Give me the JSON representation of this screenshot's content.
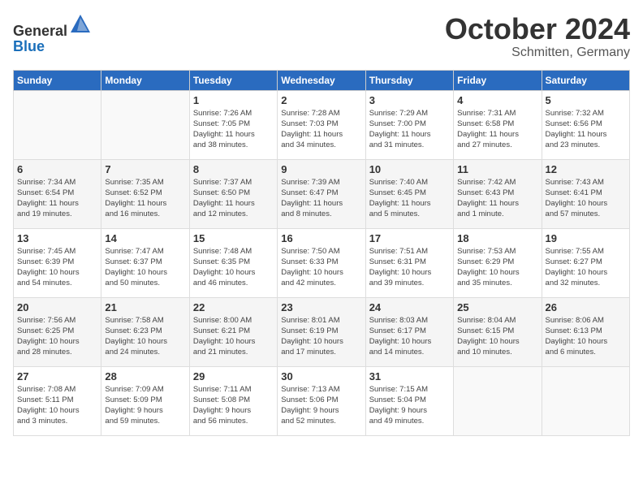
{
  "logo": {
    "general": "General",
    "blue": "Blue"
  },
  "header": {
    "month": "October 2024",
    "location": "Schmitten, Germany"
  },
  "weekdays": [
    "Sunday",
    "Monday",
    "Tuesday",
    "Wednesday",
    "Thursday",
    "Friday",
    "Saturday"
  ],
  "weeks": [
    [
      {
        "day": "",
        "info": ""
      },
      {
        "day": "",
        "info": ""
      },
      {
        "day": "1",
        "info": "Sunrise: 7:26 AM\nSunset: 7:05 PM\nDaylight: 11 hours\nand 38 minutes."
      },
      {
        "day": "2",
        "info": "Sunrise: 7:28 AM\nSunset: 7:03 PM\nDaylight: 11 hours\nand 34 minutes."
      },
      {
        "day": "3",
        "info": "Sunrise: 7:29 AM\nSunset: 7:00 PM\nDaylight: 11 hours\nand 31 minutes."
      },
      {
        "day": "4",
        "info": "Sunrise: 7:31 AM\nSunset: 6:58 PM\nDaylight: 11 hours\nand 27 minutes."
      },
      {
        "day": "5",
        "info": "Sunrise: 7:32 AM\nSunset: 6:56 PM\nDaylight: 11 hours\nand 23 minutes."
      }
    ],
    [
      {
        "day": "6",
        "info": "Sunrise: 7:34 AM\nSunset: 6:54 PM\nDaylight: 11 hours\nand 19 minutes."
      },
      {
        "day": "7",
        "info": "Sunrise: 7:35 AM\nSunset: 6:52 PM\nDaylight: 11 hours\nand 16 minutes."
      },
      {
        "day": "8",
        "info": "Sunrise: 7:37 AM\nSunset: 6:50 PM\nDaylight: 11 hours\nand 12 minutes."
      },
      {
        "day": "9",
        "info": "Sunrise: 7:39 AM\nSunset: 6:47 PM\nDaylight: 11 hours\nand 8 minutes."
      },
      {
        "day": "10",
        "info": "Sunrise: 7:40 AM\nSunset: 6:45 PM\nDaylight: 11 hours\nand 5 minutes."
      },
      {
        "day": "11",
        "info": "Sunrise: 7:42 AM\nSunset: 6:43 PM\nDaylight: 11 hours\nand 1 minute."
      },
      {
        "day": "12",
        "info": "Sunrise: 7:43 AM\nSunset: 6:41 PM\nDaylight: 10 hours\nand 57 minutes."
      }
    ],
    [
      {
        "day": "13",
        "info": "Sunrise: 7:45 AM\nSunset: 6:39 PM\nDaylight: 10 hours\nand 54 minutes."
      },
      {
        "day": "14",
        "info": "Sunrise: 7:47 AM\nSunset: 6:37 PM\nDaylight: 10 hours\nand 50 minutes."
      },
      {
        "day": "15",
        "info": "Sunrise: 7:48 AM\nSunset: 6:35 PM\nDaylight: 10 hours\nand 46 minutes."
      },
      {
        "day": "16",
        "info": "Sunrise: 7:50 AM\nSunset: 6:33 PM\nDaylight: 10 hours\nand 42 minutes."
      },
      {
        "day": "17",
        "info": "Sunrise: 7:51 AM\nSunset: 6:31 PM\nDaylight: 10 hours\nand 39 minutes."
      },
      {
        "day": "18",
        "info": "Sunrise: 7:53 AM\nSunset: 6:29 PM\nDaylight: 10 hours\nand 35 minutes."
      },
      {
        "day": "19",
        "info": "Sunrise: 7:55 AM\nSunset: 6:27 PM\nDaylight: 10 hours\nand 32 minutes."
      }
    ],
    [
      {
        "day": "20",
        "info": "Sunrise: 7:56 AM\nSunset: 6:25 PM\nDaylight: 10 hours\nand 28 minutes."
      },
      {
        "day": "21",
        "info": "Sunrise: 7:58 AM\nSunset: 6:23 PM\nDaylight: 10 hours\nand 24 minutes."
      },
      {
        "day": "22",
        "info": "Sunrise: 8:00 AM\nSunset: 6:21 PM\nDaylight: 10 hours\nand 21 minutes."
      },
      {
        "day": "23",
        "info": "Sunrise: 8:01 AM\nSunset: 6:19 PM\nDaylight: 10 hours\nand 17 minutes."
      },
      {
        "day": "24",
        "info": "Sunrise: 8:03 AM\nSunset: 6:17 PM\nDaylight: 10 hours\nand 14 minutes."
      },
      {
        "day": "25",
        "info": "Sunrise: 8:04 AM\nSunset: 6:15 PM\nDaylight: 10 hours\nand 10 minutes."
      },
      {
        "day": "26",
        "info": "Sunrise: 8:06 AM\nSunset: 6:13 PM\nDaylight: 10 hours\nand 6 minutes."
      }
    ],
    [
      {
        "day": "27",
        "info": "Sunrise: 7:08 AM\nSunset: 5:11 PM\nDaylight: 10 hours\nand 3 minutes."
      },
      {
        "day": "28",
        "info": "Sunrise: 7:09 AM\nSunset: 5:09 PM\nDaylight: 9 hours\nand 59 minutes."
      },
      {
        "day": "29",
        "info": "Sunrise: 7:11 AM\nSunset: 5:08 PM\nDaylight: 9 hours\nand 56 minutes."
      },
      {
        "day": "30",
        "info": "Sunrise: 7:13 AM\nSunset: 5:06 PM\nDaylight: 9 hours\nand 52 minutes."
      },
      {
        "day": "31",
        "info": "Sunrise: 7:15 AM\nSunset: 5:04 PM\nDaylight: 9 hours\nand 49 minutes."
      },
      {
        "day": "",
        "info": ""
      },
      {
        "day": "",
        "info": ""
      }
    ]
  ]
}
